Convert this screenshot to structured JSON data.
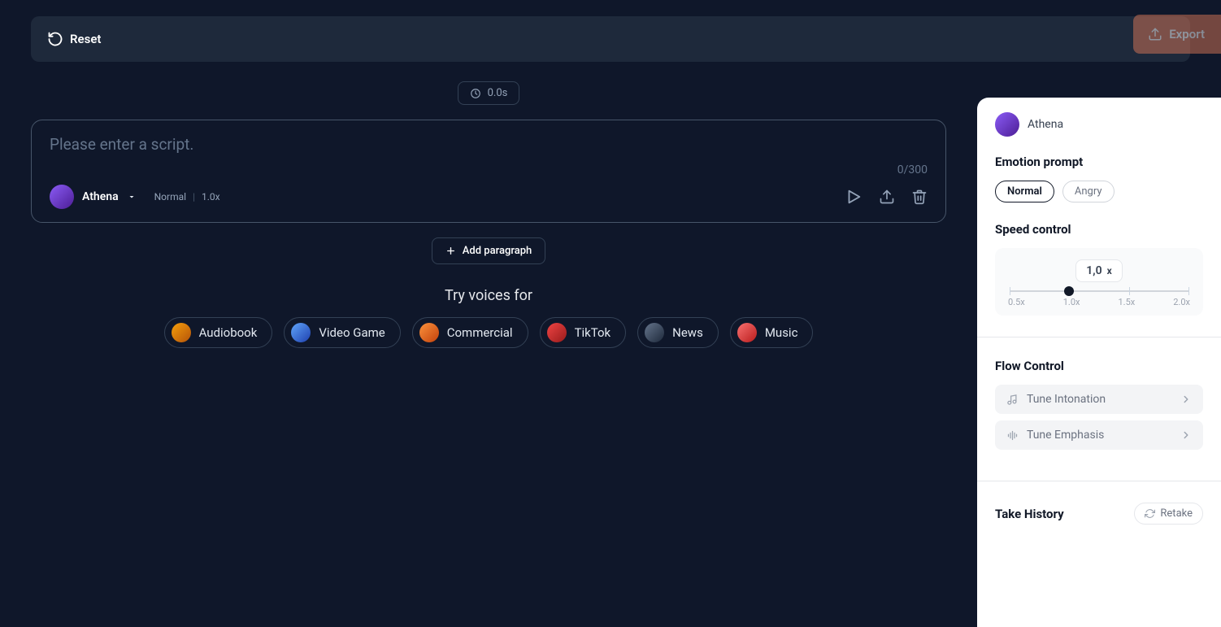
{
  "topbar": {
    "reset_label": "Reset",
    "export_label": "Export"
  },
  "duration": "0.0s",
  "script": {
    "placeholder": "Please enter a script.",
    "char_count": "0/300",
    "voice_name": "Athena",
    "emotion": "Normal",
    "speed": "1.0x"
  },
  "add_paragraph": "Add paragraph",
  "try_voices": {
    "title": "Try voices for",
    "chips": [
      "Audiobook",
      "Video Game",
      "Commercial",
      "TikTok",
      "News",
      "Music"
    ]
  },
  "sidepanel": {
    "voice_name": "Athena",
    "emotion_title": "Emotion prompt",
    "emotions": [
      "Normal",
      "Angry"
    ],
    "emotion_active_index": 0,
    "speed_title": "Speed control",
    "speed_value": "1,0",
    "speed_suffix": "x",
    "speed_ticks": [
      "0.5x",
      "1.0x",
      "1.5x",
      "2.0x"
    ],
    "flow_title": "Flow Control",
    "flow_items": [
      "Tune Intonation",
      "Tune Emphasis"
    ],
    "take_history_title": "Take History",
    "retake_label": "Retake"
  }
}
